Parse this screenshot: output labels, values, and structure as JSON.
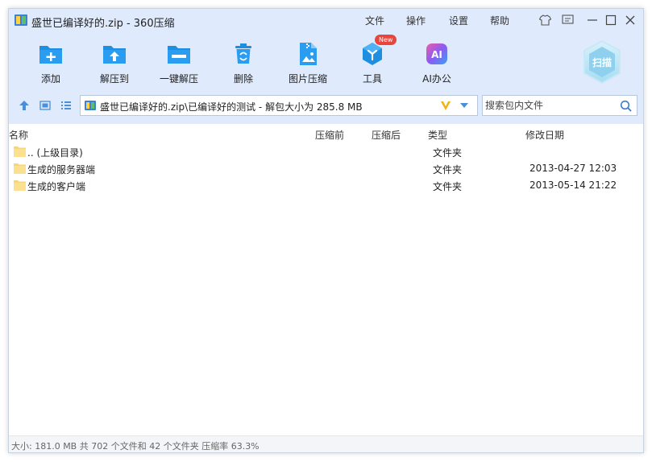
{
  "window": {
    "title": "盛世已编译好的.zip - 360压缩"
  },
  "menu": [
    "文件",
    "操作",
    "设置",
    "帮助"
  ],
  "toolbar": {
    "add": "添加",
    "extract_to": "解压到",
    "one_click": "一键解压",
    "delete": "删除",
    "image_compress": "图片压缩",
    "tools": "工具",
    "tools_badge": "New",
    "ai_office": "AI办公",
    "ai_icon_text": "AI",
    "scan": "扫描"
  },
  "address": {
    "path": "盛世已编译好的.zip\\已编译好的测试 - 解包大小为 285.8 MB"
  },
  "search": {
    "placeholder": "搜索包内文件"
  },
  "columns": {
    "name": "名称",
    "before": "压缩前",
    "after": "压缩后",
    "type": "类型",
    "modified": "修改日期"
  },
  "rows": [
    {
      "name": ".. (上级目录)",
      "type": "文件夹",
      "date": ""
    },
    {
      "name": "生成的服务器端",
      "type": "文件夹",
      "date": "2013-04-27 12:03"
    },
    {
      "name": "生成的客户端",
      "type": "文件夹",
      "date": "2013-05-14 21:22"
    }
  ],
  "status": "大小: 181.0 MB 共 702 个文件和 42 个文件夹 压缩率 63.3%",
  "colors": {
    "accent": "#1e8ee0",
    "toolbar_bg": "#dfeafc",
    "folder": "#f7d57a",
    "badge": "#e8453c"
  }
}
